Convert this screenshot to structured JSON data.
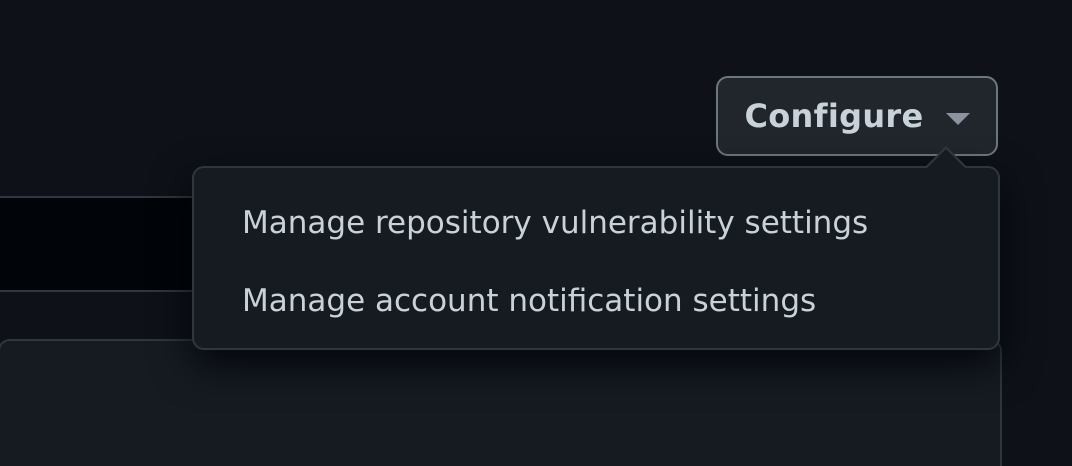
{
  "toolbar": {
    "configure_label": "Configure",
    "configure_icon": "triangle-down-icon"
  },
  "menu": {
    "items": [
      {
        "label": "Manage repository vulnerability settings"
      },
      {
        "label": "Manage account notification settings"
      }
    ]
  },
  "colors": {
    "page_background": "#0e1118",
    "menu_background": "#161b22",
    "border": "#30363d",
    "button_border": "#6e7681",
    "text": "#c9d1d9"
  }
}
